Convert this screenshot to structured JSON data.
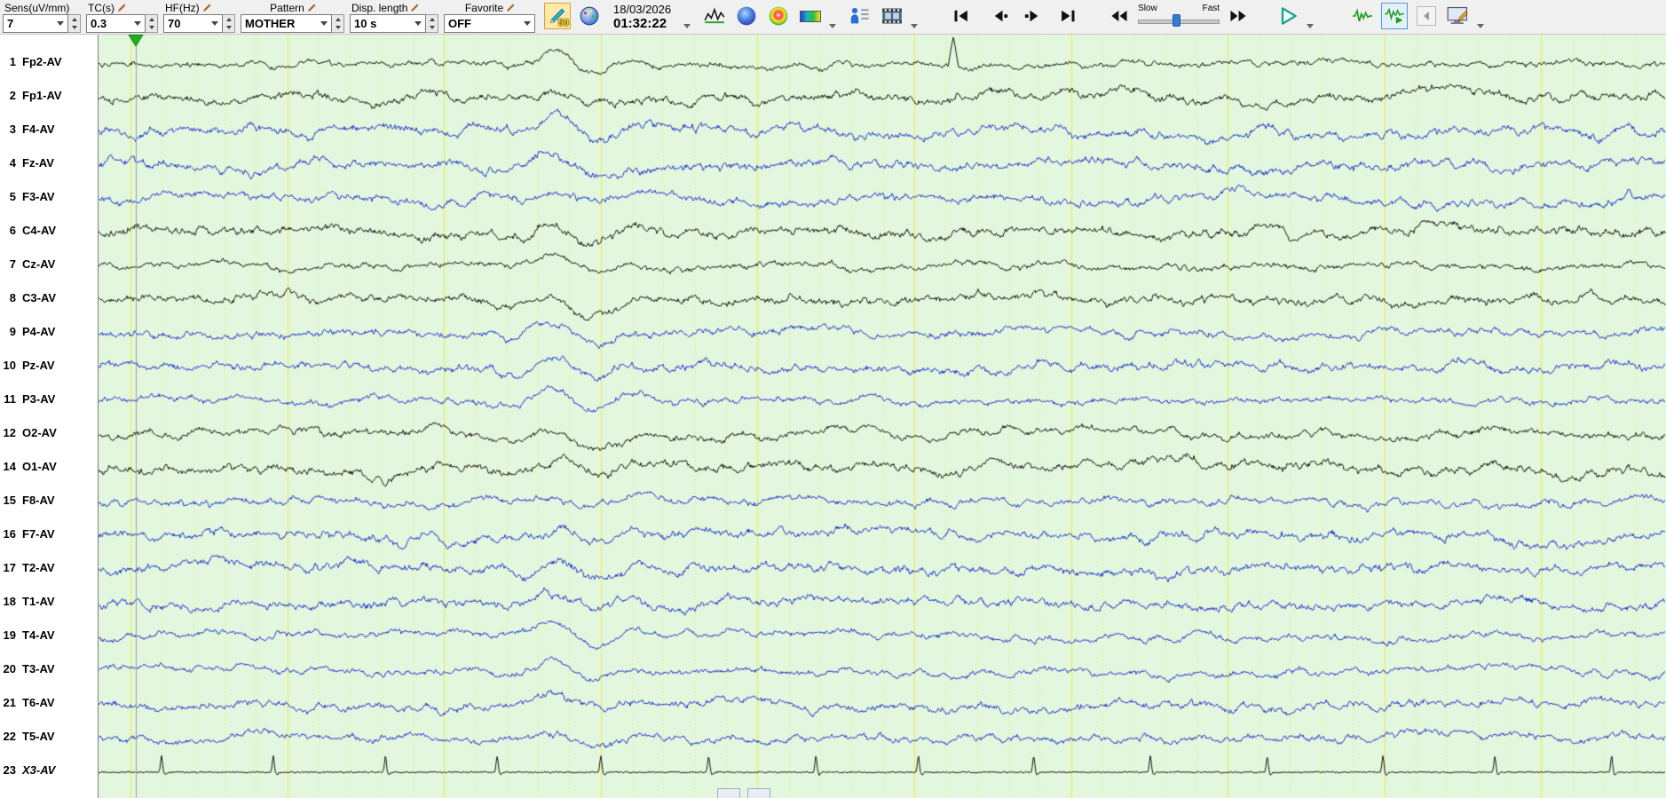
{
  "toolbar": {
    "sens": {
      "label": "Sens(uV/mm)",
      "value": "7"
    },
    "tc": {
      "label": "TC(s)",
      "value": "0.3"
    },
    "hf": {
      "label": "HF(Hz)",
      "value": "70"
    },
    "pattern": {
      "label": "Pattern",
      "value": "MOTHER"
    },
    "disp_length": {
      "label": "Disp. length",
      "value": "10 s"
    },
    "favorite": {
      "label": "Favorite",
      "value": "OFF"
    },
    "marker_badge": "50",
    "date": "18/03/2026",
    "time": "01:32:22",
    "speed": {
      "slow": "Slow",
      "fast": "Fast"
    }
  },
  "channels": [
    {
      "num": "1",
      "label": "Fp2-AV",
      "color": "#161616"
    },
    {
      "num": "2",
      "label": "Fp1-AV",
      "color": "#161616"
    },
    {
      "num": "3",
      "label": "F4-AV",
      "color": "#2433cf"
    },
    {
      "num": "4",
      "label": "Fz-AV",
      "color": "#2433cf"
    },
    {
      "num": "5",
      "label": "F3-AV",
      "color": "#2433cf"
    },
    {
      "num": "6",
      "label": "C4-AV",
      "color": "#161616"
    },
    {
      "num": "7",
      "label": "Cz-AV",
      "color": "#161616"
    },
    {
      "num": "8",
      "label": "C3-AV",
      "color": "#161616"
    },
    {
      "num": "9",
      "label": "P4-AV",
      "color": "#2433cf"
    },
    {
      "num": "10",
      "label": "Pz-AV",
      "color": "#2433cf"
    },
    {
      "num": "11",
      "label": "P3-AV",
      "color": "#2433cf"
    },
    {
      "num": "12",
      "label": "O2-AV",
      "color": "#161616"
    },
    {
      "num": "14",
      "label": "O1-AV",
      "color": "#161616"
    },
    {
      "num": "15",
      "label": "F8-AV",
      "color": "#2433cf"
    },
    {
      "num": "16",
      "label": "F7-AV",
      "color": "#2433cf"
    },
    {
      "num": "17",
      "label": "T2-AV",
      "color": "#2433cf"
    },
    {
      "num": "18",
      "label": "T1-AV",
      "color": "#2433cf"
    },
    {
      "num": "19",
      "label": "T4-AV",
      "color": "#2433cf"
    },
    {
      "num": "20",
      "label": "T3-AV",
      "color": "#2433cf"
    },
    {
      "num": "21",
      "label": "T6-AV",
      "color": "#2433cf"
    },
    {
      "num": "22",
      "label": "T5-AV",
      "color": "#2433cf"
    },
    {
      "num": "23",
      "label": "X3-AV",
      "color": "#161616",
      "italic": true,
      "type": "ecg"
    }
  ],
  "display": {
    "seconds": 10,
    "bg": "#e2f7dd",
    "grid_yellow": "#f1e94e",
    "cursor_color": "#a0a0a0",
    "marker_green": "#1db21d",
    "trace_blue": "#2433cf",
    "trace_black": "#161616"
  }
}
